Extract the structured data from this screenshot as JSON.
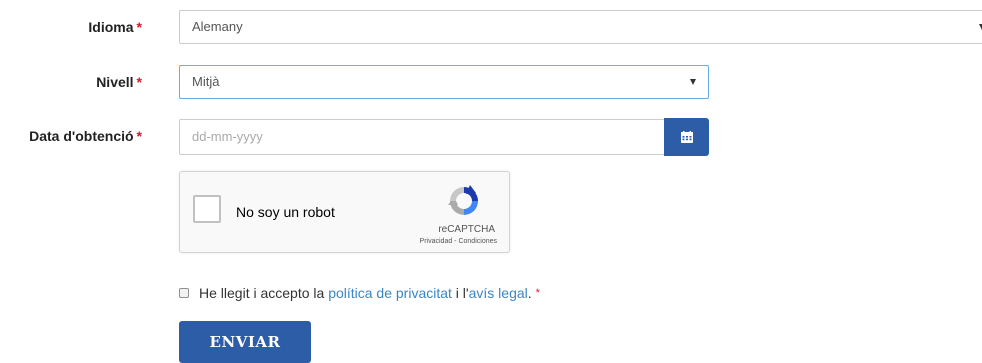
{
  "form": {
    "required_mark": "*",
    "idioma": {
      "label": "Idioma",
      "value": "Alemany"
    },
    "nivell": {
      "label": "Nivell",
      "value": "Mitjà"
    },
    "data": {
      "label": "Data d'obtenció",
      "placeholder": "dd-mm-yyyy",
      "icon": "calendar-icon"
    },
    "captcha": {
      "checkbox_label": "No soy un robot",
      "brand": "reCAPTCHA",
      "privacy": "Privacidad",
      "separator": " - ",
      "terms": "Condiciones",
      "icon": "recaptcha-logo"
    },
    "consent": {
      "prefix": "He llegit i accepto la ",
      "privacy_link": "política de privacitat",
      "middle": " i l'",
      "legal_link": "avís legal",
      "suffix": "."
    },
    "submit_label": "ENVIAR"
  },
  "colors": {
    "primary": "#2e5da8",
    "required": "#d9182d",
    "link": "#3b86c6",
    "focus_border": "#66afe9"
  }
}
